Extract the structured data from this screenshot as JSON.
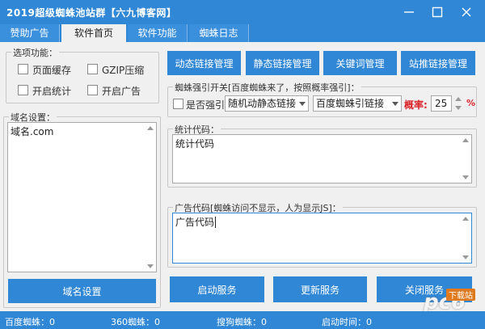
{
  "window": {
    "title": "2019超级蜘蛛池站群【六九博客网】"
  },
  "tabs": [
    {
      "label": "赞助广告",
      "active": false
    },
    {
      "label": "软件首页",
      "active": true
    },
    {
      "label": "软件功能",
      "active": false
    },
    {
      "label": "蜘蛛日志",
      "active": false
    }
  ],
  "options": {
    "legend": "选项功能：",
    "page_cache": "页面缓存",
    "gzip": "GZIP压缩",
    "enable_stats": "开启统计",
    "enable_ads": "开启广告"
  },
  "domain": {
    "legend": "域名设置：",
    "value": "域名.com",
    "button": "域名设置"
  },
  "management": {
    "dynamic_link": "动态链接管理",
    "static_link": "静态链接管理",
    "keyword": "关键词管理",
    "site_push": "站推链接管理"
  },
  "spider": {
    "legend": "蜘蛛强引开关[百度蜘蛛来了，按照概率强引]：",
    "force_label": "是否强引",
    "mode_select": "随机动静态链接",
    "engine_select": "百度蜘蛛引链接",
    "prob_label": "概率:",
    "prob_value": "25",
    "percent": "%"
  },
  "stats": {
    "legend": "统计代码：",
    "value": "统计代码"
  },
  "ads": {
    "legend": "广告代码[蜘蛛访问不显示，人为显示JS]：",
    "value": "广告代码"
  },
  "services": {
    "start": "启动服务",
    "update": "更新服务",
    "stop": "关闭服务"
  },
  "status": {
    "baidu": "百度蜘蛛：0",
    "s360": "360蜘蛛：0",
    "sogou": "搜狗蜘蛛：0",
    "start_time": "启动时间：0"
  },
  "watermark": {
    "text": "pc6",
    "sub": "下载站"
  },
  "colors": {
    "accent": "#2f87d6",
    "probability": "#d9262c"
  }
}
